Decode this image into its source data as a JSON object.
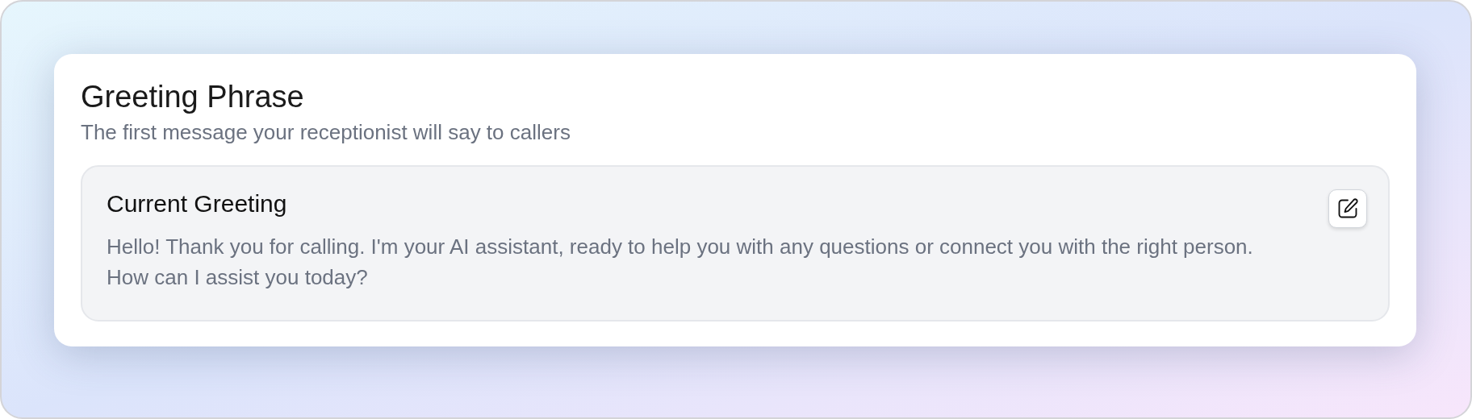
{
  "card": {
    "title": "Greeting Phrase",
    "subtitle": "The first message your receptionist will say to callers"
  },
  "greeting": {
    "heading": "Current Greeting",
    "text": "Hello! Thank you for calling. I'm your AI assistant, ready to help you with any questions or connect you with the right person. How can I assist you today?"
  }
}
